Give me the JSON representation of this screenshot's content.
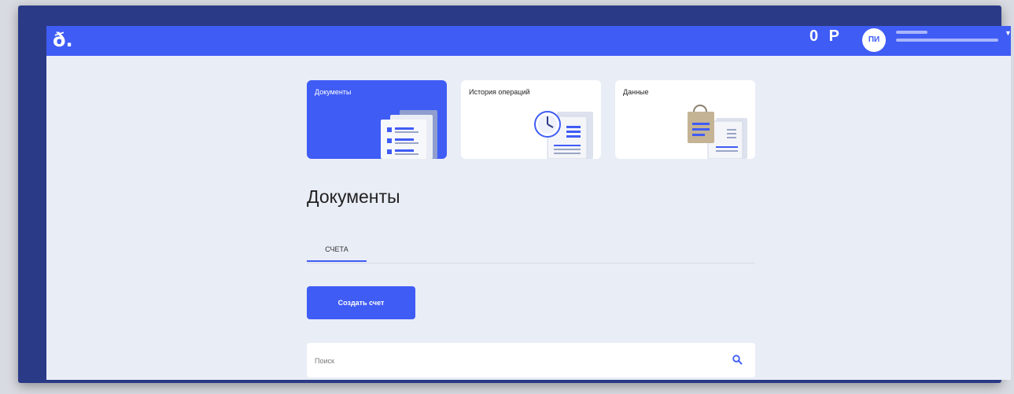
{
  "header": {
    "logo": "ð.",
    "op_text": "0 P",
    "avatar_initials": "ПИ",
    "accent_color": "#3f5cf5"
  },
  "cards": [
    {
      "label": "Документы",
      "active": true,
      "icon": "documents-illustration"
    },
    {
      "label": "История операций",
      "active": false,
      "icon": "clock-history-illustration"
    },
    {
      "label": "Данные",
      "active": false,
      "icon": "data-bag-illustration"
    }
  ],
  "main": {
    "title": "Документы",
    "tabs": [
      {
        "label": "СЧЕТА",
        "active": true
      }
    ],
    "create_button": "Создать счет",
    "search": {
      "placeholder": "Поиск",
      "icon": "search-icon"
    }
  }
}
